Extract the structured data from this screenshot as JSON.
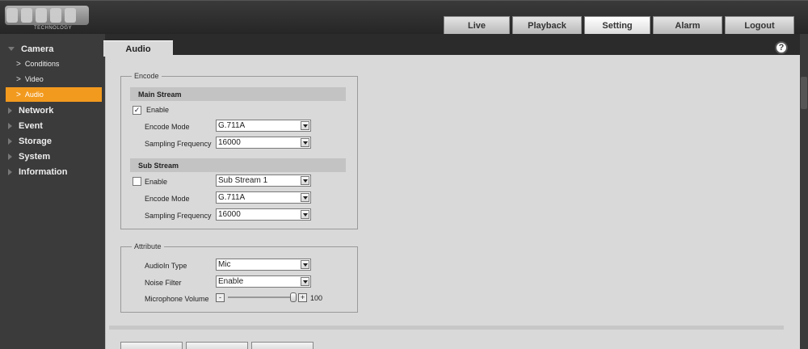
{
  "header": {
    "logo_text": "TECHNOLOGY",
    "nav": [
      "Live",
      "Playback",
      "Setting",
      "Alarm",
      "Logout"
    ],
    "active_nav": "Setting"
  },
  "sidebar": {
    "camera": "Camera",
    "sub": [
      "Conditions",
      "Video",
      "Audio"
    ],
    "items": [
      "Network",
      "Event",
      "Storage",
      "System",
      "Information"
    ]
  },
  "tab": "Audio",
  "help_icon": "?",
  "encode": {
    "legend": "Encode",
    "main_stream": {
      "title": "Main Stream",
      "enable_label": "Enable",
      "enabled": true,
      "encode_mode_label": "Encode Mode",
      "encode_mode": "G.711A",
      "sampling_label": "Sampling Frequency",
      "sampling": "16000"
    },
    "sub_stream": {
      "title": "Sub Stream",
      "enable_label": "Enable",
      "enabled": false,
      "stream_select": "Sub Stream 1",
      "encode_mode_label": "Encode Mode",
      "encode_mode": "G.711A",
      "sampling_label": "Sampling Frequency",
      "sampling": "16000"
    }
  },
  "attribute": {
    "legend": "Attribute",
    "audioin_label": "AudioIn Type",
    "audioin": "Mic",
    "noise_label": "Noise Filter",
    "noise": "Enable",
    "volume_label": "Microphone Volume",
    "volume": "100",
    "minus": "-",
    "plus": "+"
  },
  "check_mark": "✓"
}
